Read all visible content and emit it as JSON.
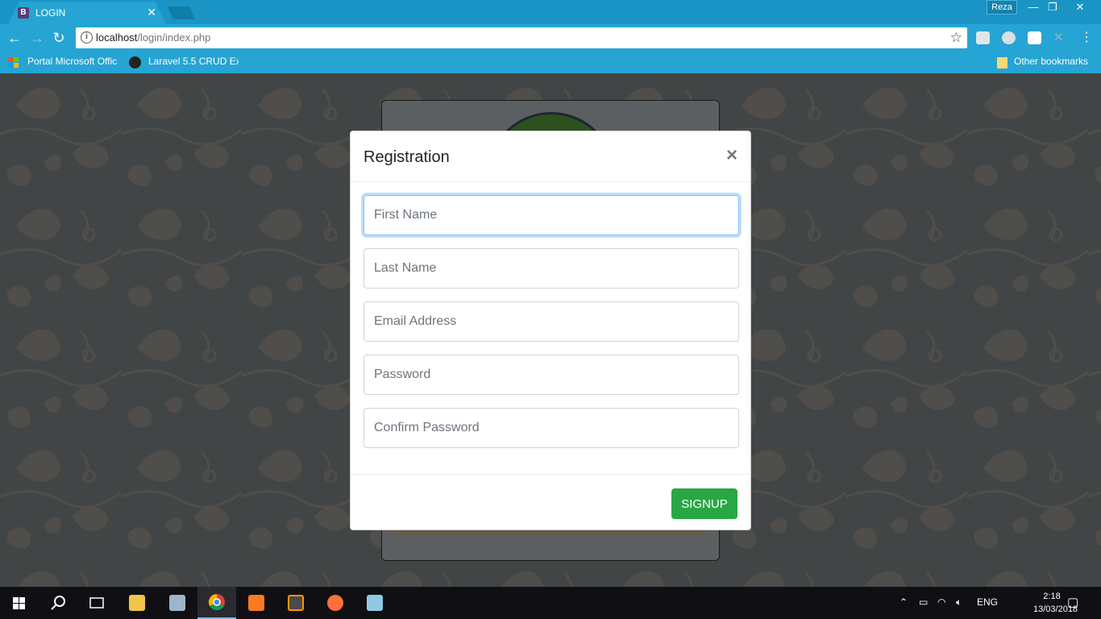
{
  "browser": {
    "tab_title": "LOGIN",
    "tab_favicon": "B",
    "profile_name": "Reza",
    "url_host": "localhost",
    "url_path": "/login/index.php",
    "bookmarks": [
      {
        "label": "Portal Microsoft Offic"
      },
      {
        "label": "Laravel 5.5 CRUD Exa"
      }
    ],
    "other_bookmarks": "Other bookmarks"
  },
  "modal": {
    "title": "Registration",
    "close_glyph": "×",
    "fields": {
      "first_name": {
        "placeholder": "First Name",
        "value": ""
      },
      "last_name": {
        "placeholder": "Last Name",
        "value": ""
      },
      "email": {
        "placeholder": "Email Address",
        "value": ""
      },
      "password": {
        "placeholder": "Password",
        "value": ""
      },
      "confirm_password": {
        "placeholder": "Confirm Password",
        "value": ""
      }
    },
    "submit_label": "SIGNUP"
  },
  "taskbar": {
    "language": "ENG",
    "time": "2:18",
    "date": "13/03/2018"
  },
  "colors": {
    "chrome_blue": "#26a4d3",
    "signup_green": "#28a745",
    "focus_border": "#80bdff"
  }
}
